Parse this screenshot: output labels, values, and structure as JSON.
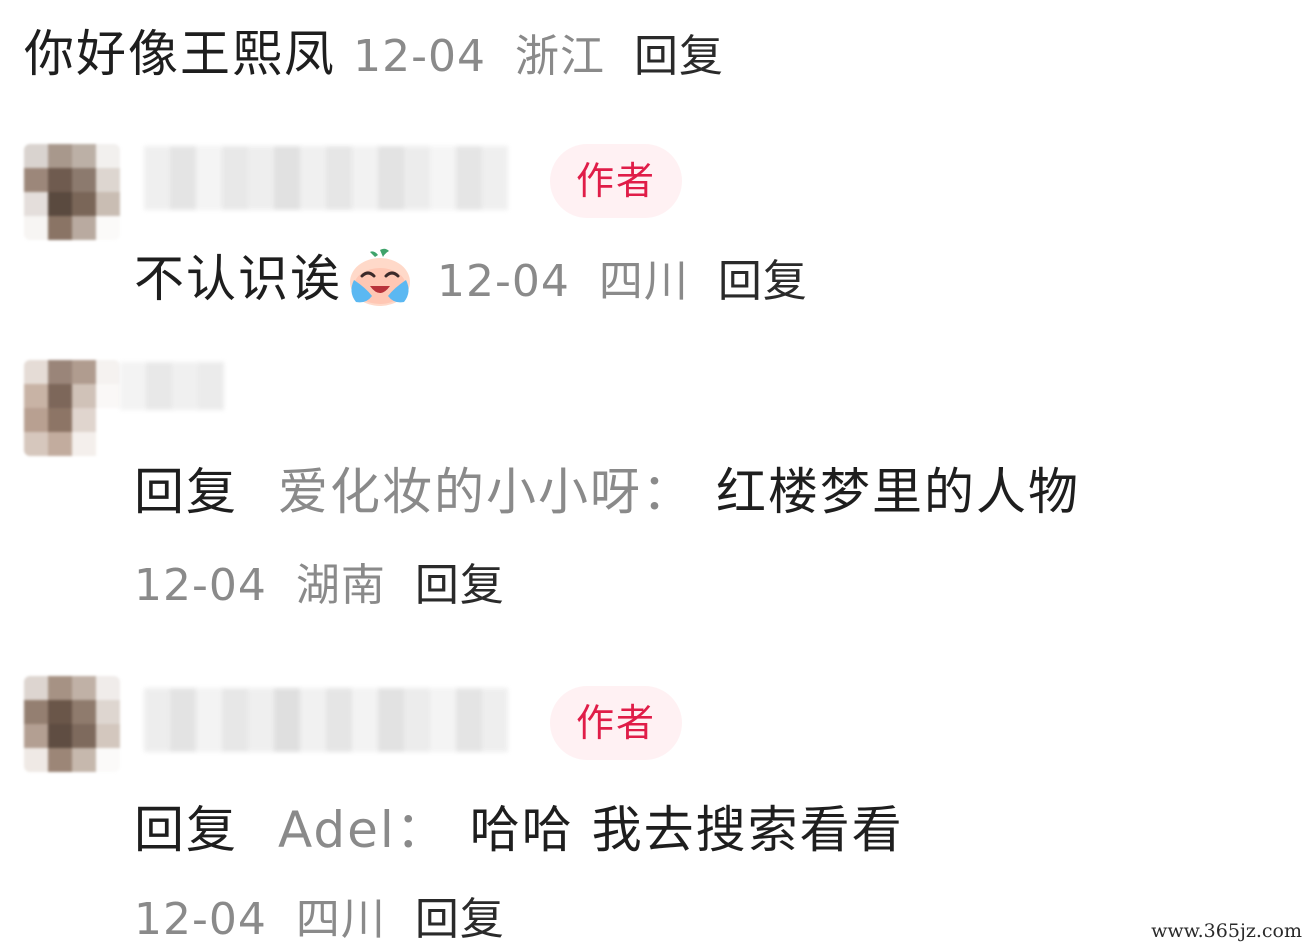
{
  "comment": {
    "text": "你好像王熙凤",
    "date": "12-04",
    "location": "浙江",
    "reply_label": "回复"
  },
  "replies": [
    {
      "badge": "作者",
      "text": "不认识诶",
      "emoji": "crying-laughing-face-icon",
      "date": "12-04",
      "location": "四川",
      "reply_label": "回复"
    },
    {
      "prefix": "回复",
      "target_user": "爱化妆的小小呀：",
      "text": "红楼梦里的人物",
      "date": "12-04",
      "location": "湖南",
      "reply_label": "回复"
    },
    {
      "badge": "作者",
      "prefix": "回复",
      "target_user": "Adel：",
      "text": "哈哈 我去搜索看看",
      "date": "12-04",
      "location": "四川",
      "reply_label": "回复"
    }
  ],
  "watermark": "www.365jz.com",
  "colors": {
    "badge_text": "#e01d48",
    "badge_bg": "#fff1f3",
    "meta_text": "#8a8a8a",
    "body_text": "#1e1e1e"
  }
}
